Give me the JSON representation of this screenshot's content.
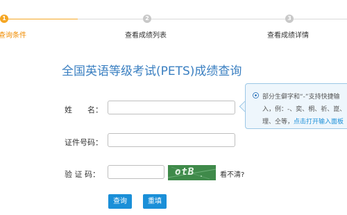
{
  "steps": [
    {
      "num": "1",
      "label": "查询条件"
    },
    {
      "num": "2",
      "label": "查看成绩列表"
    },
    {
      "num": "3",
      "label": "查看成绩详情"
    }
  ],
  "title": "全国英语等级考试(PETS)成绩查询",
  "form": {
    "name_label": "姓　　名：",
    "id_label": "证件号码：",
    "captcha_label": "验 证 码：",
    "captcha_text": "otB",
    "refresh_label": "看不清?",
    "name_value": "",
    "id_value": "",
    "captcha_value": ""
  },
  "buttons": {
    "query": "查询",
    "reset": "重填"
  },
  "tooltip": {
    "line1": "部分生僻字和“-”支持快捷输",
    "line2": "入，例：-、奕、桐、祈、崑、",
    "line3_text": "理、仝等，",
    "line3_link": "点击打开输入面板"
  },
  "colors": {
    "accent": "#f5a623",
    "title": "#3a7fc1",
    "button": "#1a8fd8"
  }
}
